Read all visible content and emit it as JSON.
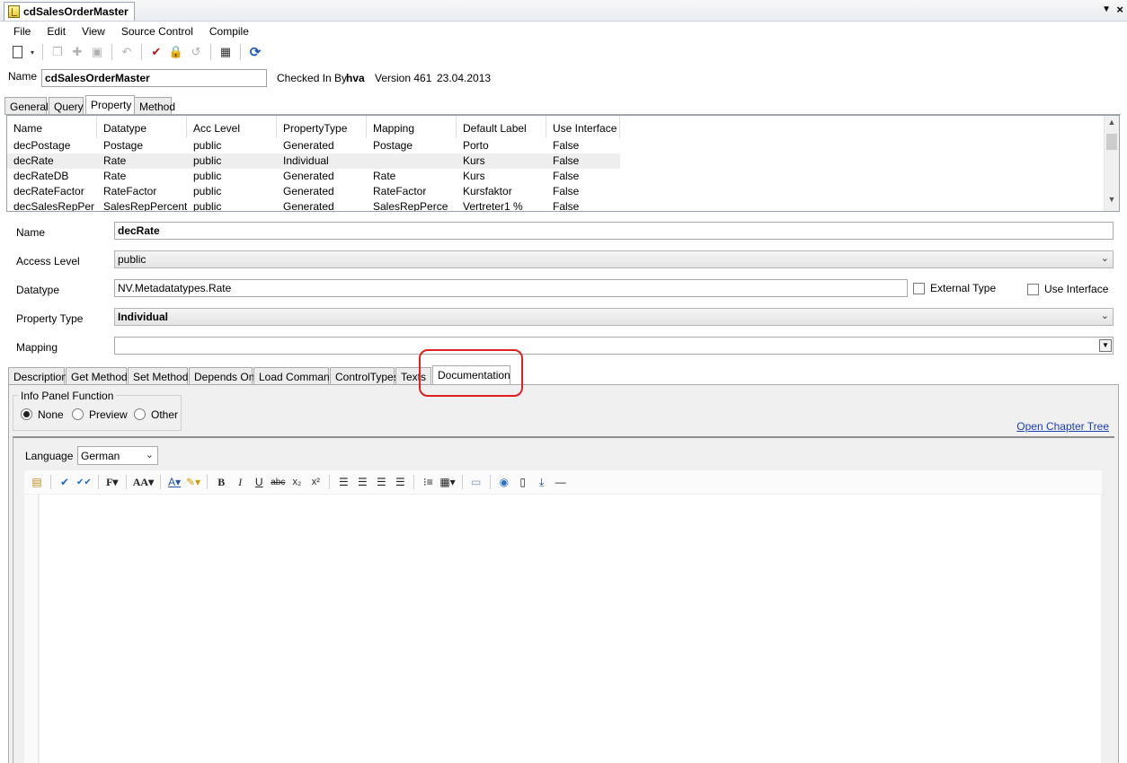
{
  "window": {
    "doc_title": "cdSalesOrderMaster"
  },
  "menu": [
    "File",
    "Edit",
    "View",
    "Source Control",
    "Compile"
  ],
  "toolbar_icons": [
    "new-document-icon",
    "copy-icon",
    "plugin-icon",
    "save-icon",
    "undo-icon",
    "checkin-icon",
    "checkout-icon",
    "revert-icon",
    "calendar-icon",
    "refresh-icon"
  ],
  "header": {
    "name_label": "Name",
    "name_value": "cdSalesOrderMaster",
    "checked_in_label": "Checked In By",
    "checked_in_user": "hva",
    "version": "Version 461",
    "date": "23.04.2013"
  },
  "top_tabs": [
    "General",
    "Query",
    "Property",
    "Method"
  ],
  "active_top_tab": "Property",
  "grid": {
    "columns": [
      "Name",
      "Datatype",
      "Acc Level",
      "PropertyType",
      "Mapping",
      "Default Label",
      "Use Interface"
    ],
    "rows": [
      [
        "decPostage",
        "Postage",
        "public",
        "Generated",
        "Postage",
        "Porto",
        "False"
      ],
      [
        "decRate",
        "Rate",
        "public",
        "Individual",
        "",
        "Kurs",
        "False"
      ],
      [
        "decRateDB",
        "Rate",
        "public",
        "Generated",
        "Rate",
        "Kurs",
        "False"
      ],
      [
        "decRateFactor",
        "RateFactor",
        "public",
        "Generated",
        "RateFactor",
        "Kursfaktor",
        "False"
      ],
      [
        "decSalesRepPer",
        "SalesRepPercent",
        "public",
        "Generated",
        "SalesRepPerce",
        "Vertreter1 %",
        "False"
      ]
    ],
    "selected_row": 1
  },
  "form": {
    "name_label": "Name",
    "name_value": "decRate",
    "access_label": "Access Level",
    "access_value": "public",
    "datatype_label": "Datatype",
    "datatype_value": "NV.Metadatatypes.Rate",
    "external_type_label": "External Type",
    "use_interface_label": "Use Interface",
    "property_type_label": "Property Type",
    "property_type_value": "Individual",
    "mapping_label": "Mapping",
    "mapping_value": ""
  },
  "bottom_tabs": [
    "Description",
    "Get Method",
    "Set Method",
    "Depends On",
    "Load Command",
    "ControlTypes",
    "Texts",
    "Documentation"
  ],
  "active_bottom_tab": "Documentation",
  "documentation": {
    "info_panel_title": "Info Panel Function",
    "radio_options": [
      "None",
      "Preview",
      "Other"
    ],
    "radio_selected": "None",
    "open_chapter_link": "Open Chapter Tree",
    "language_label": "Language",
    "language_value": "German"
  },
  "colors": {
    "highlight_red": "#e02020",
    "link_blue": "#1a3fb5"
  }
}
